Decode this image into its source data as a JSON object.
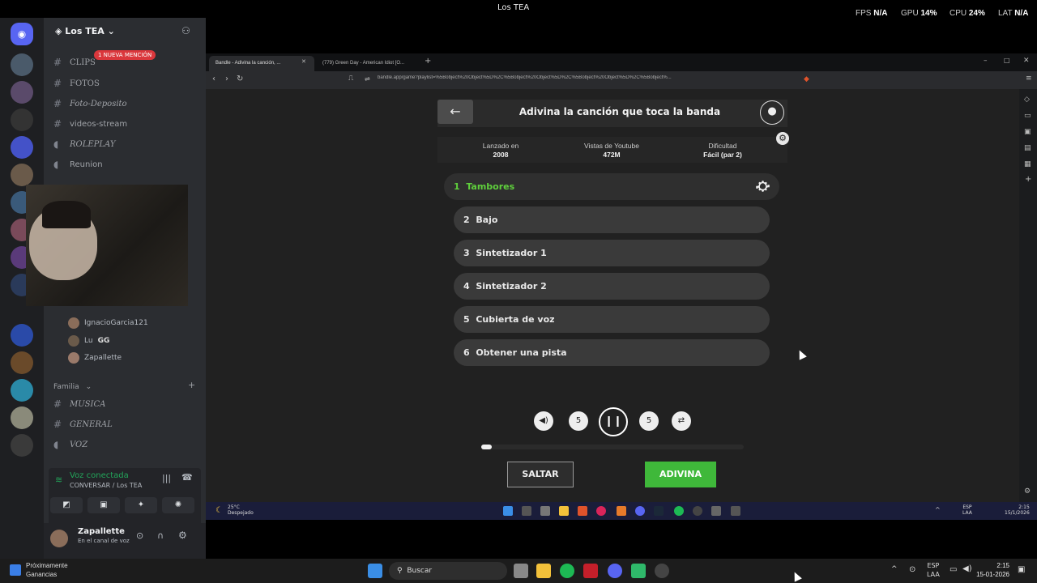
{
  "overlay": {
    "window_title": "Los TEA",
    "fps_label": "FPS",
    "fps_value": "N/A",
    "gpu_label": "GPU",
    "gpu_value": "14%",
    "cpu_label": "CPU",
    "cpu_value": "24%",
    "lat_label": "LAT",
    "lat_value": "N/A"
  },
  "discord": {
    "server_name": "Los TEA",
    "mention_badge": "1 NUEVA MENCIÓN",
    "channels": [
      {
        "name": "CLIPS",
        "type": "text"
      },
      {
        "name": "FOTOS",
        "type": "text"
      },
      {
        "name": "Foto-Deposito",
        "type": "text"
      },
      {
        "name": "videos-stream",
        "type": "text"
      },
      {
        "name": "ROLEPLAY",
        "type": "voice"
      },
      {
        "name": "Reunion",
        "type": "voice"
      }
    ],
    "members": [
      {
        "name": "IgnacioGarcia121"
      },
      {
        "name": "Lu",
        "tag": "GG"
      },
      {
        "name": "Zapallette"
      }
    ],
    "category": "Familia",
    "channels2": [
      {
        "name": "MUSICA",
        "type": "text"
      },
      {
        "name": "GENERAL",
        "type": "text"
      },
      {
        "name": "VOZ",
        "type": "voice"
      }
    ],
    "voice_status": "Voz conectada",
    "voice_channel": "CONVERSAR / Los TEA",
    "user_name": "Zapallette",
    "user_status": "En el canal de voz"
  },
  "browser": {
    "tabs": [
      {
        "label": "Bandle - Adivina la canción, ..."
      },
      {
        "label": "(779) Green Day - American Idiot [O..."
      }
    ],
    "url": "bandle.app/game?playlist=%5Bobject%20Object%5D%2C%5Bobject%20Object%5D%2C%5Bobject%20Object%5D%2C%5Bobject%..."
  },
  "bandle": {
    "title": "Adivina la canción que toca la banda",
    "info": [
      {
        "label": "Lanzado en",
        "value": "2008"
      },
      {
        "label": "Vistas de Youtube",
        "value": "472M"
      },
      {
        "label": "Dificultad",
        "value": "Fácil (par 2)"
      }
    ],
    "tracks": [
      {
        "num": "1",
        "label": "Tambores",
        "active": true
      },
      {
        "num": "2",
        "label": "Bajo",
        "active": false
      },
      {
        "num": "3",
        "label": "Sintetizador 1",
        "active": false
      },
      {
        "num": "4",
        "label": "Sintetizador 2",
        "active": false
      },
      {
        "num": "5",
        "label": "Cubierta de voz",
        "active": false
      },
      {
        "num": "6",
        "label": "Obtener una pista",
        "active": false
      }
    ],
    "rewind_label": "5",
    "forward_label": "5",
    "progress": 0.04,
    "skip_label": "SALTAR",
    "guess_label": "ADIVINA",
    "accent_green": "#3fb83a",
    "active_track_color": "#5fcf3c"
  },
  "inner_taskbar": {
    "weather_temp": "25°C",
    "weather_desc": "Despejado",
    "lang": "ESP",
    "lang2": "LAA",
    "time": "2:15",
    "date": "15/1/2026"
  },
  "taskbar": {
    "widget_title": "Próximamente",
    "widget_sub": "Ganancias",
    "search_placeholder": "Buscar",
    "lang": "ESP",
    "lang2": "LAA",
    "time": "2:15",
    "date": "15-01-2026"
  }
}
